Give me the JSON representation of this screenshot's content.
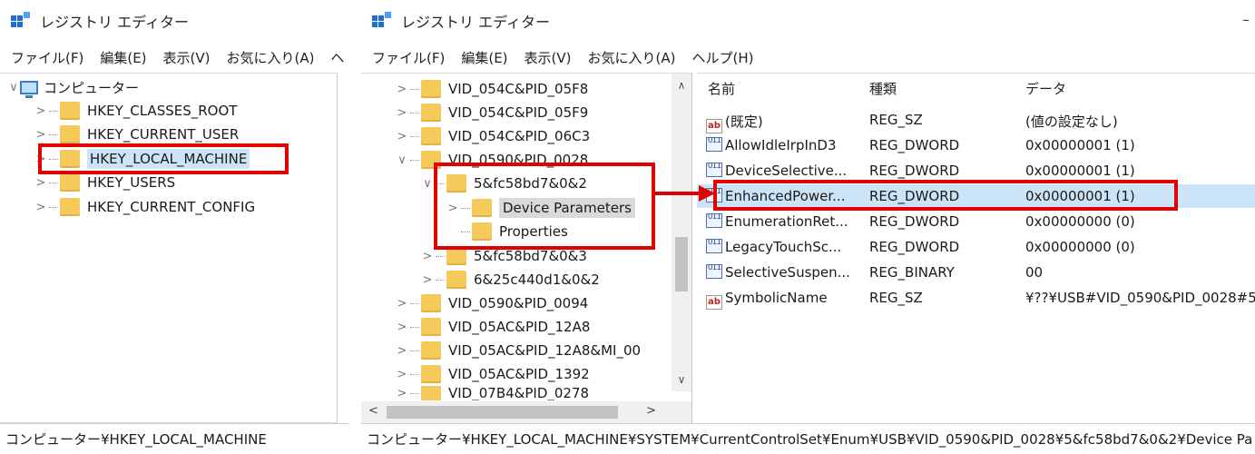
{
  "left_window": {
    "title": "レジストリ エディター",
    "menu": [
      "ファイル(F)",
      "編集(E)",
      "表示(V)",
      "お気に入り(A)",
      "ヘ"
    ],
    "tree": [
      {
        "label": "コンピューター",
        "expander": "∨"
      },
      {
        "label": "HKEY_CLASSES_ROOT",
        "expander": ">"
      },
      {
        "label": "HKEY_CURRENT_USER",
        "expander": ">"
      },
      {
        "label": "HKEY_LOCAL_MACHINE",
        "expander": ">"
      },
      {
        "label": "HKEY_USERS",
        "expander": ">"
      },
      {
        "label": "HKEY_CURRENT_CONFIG",
        "expander": ">"
      }
    ],
    "status": "コンピューター¥HKEY_LOCAL_MACHINE"
  },
  "right_window": {
    "title": "レジストリ エディター",
    "minimize": "–",
    "menu": [
      "ファイル(F)",
      "編集(E)",
      "表示(V)",
      "お気に入り(A)",
      "ヘルプ(H)"
    ],
    "tree": [
      {
        "label": "VID_054C&PID_05F8",
        "expander": ">"
      },
      {
        "label": "VID_054C&PID_05F9",
        "expander": ">"
      },
      {
        "label": "VID_054C&PID_06C3",
        "expander": ">"
      },
      {
        "label": "VID_0590&PID_0028",
        "expander": "∨"
      },
      {
        "label": "5&fc58bd7&0&2",
        "expander": "∨"
      },
      {
        "label": "Device Parameters",
        "expander": ">"
      },
      {
        "label": "Properties",
        "expander": ""
      },
      {
        "label": "5&fc58bd7&0&3",
        "expander": ">"
      },
      {
        "label": "6&25c440d1&0&2",
        "expander": ">"
      },
      {
        "label": "VID_0590&PID_0094",
        "expander": ">"
      },
      {
        "label": "VID_05AC&PID_12A8",
        "expander": ">"
      },
      {
        "label": "VID_05AC&PID_12A8&MI_00",
        "expander": ">"
      },
      {
        "label": "VID_05AC&PID_1392",
        "expander": ">"
      },
      {
        "label": "VID_07B4&PID_0278",
        "expander": ">"
      }
    ],
    "scroll": {
      "up": "∧",
      "down": "∨",
      "left": "<",
      "right": ">"
    },
    "columns": {
      "name": "名前",
      "type": "種類",
      "data": "データ"
    },
    "values": [
      {
        "icon": "ab",
        "name": "(既定)",
        "type": "REG_SZ",
        "data": "(値の設定なし)"
      },
      {
        "icon": "011",
        "name": "AllowIdleIrpInD3",
        "type": "REG_DWORD",
        "data": "0x00000001 (1)"
      },
      {
        "icon": "011",
        "name": "DeviceSelective...",
        "type": "REG_DWORD",
        "data": "0x00000001 (1)"
      },
      {
        "icon": "011",
        "name": "EnhancedPower...",
        "type": "REG_DWORD",
        "data": "0x00000001 (1)"
      },
      {
        "icon": "011",
        "name": "EnumerationRet...",
        "type": "REG_DWORD",
        "data": "0x00000000 (0)"
      },
      {
        "icon": "011",
        "name": "LegacyTouchSc...",
        "type": "REG_DWORD",
        "data": "0x00000000 (0)"
      },
      {
        "icon": "011",
        "name": "SelectiveSuspen...",
        "type": "REG_BINARY",
        "data": "00"
      },
      {
        "icon": "ab",
        "name": "SymbolicName",
        "type": "REG_SZ",
        "data": "¥??¥USB#VID_0590&PID_0028#5&"
      }
    ],
    "status": "コンピューター¥HKEY_LOCAL_MACHINE¥SYSTEM¥CurrentControlSet¥Enum¥USB¥VID_0590&PID_0028¥5&fc58bd7&0&2¥Device Pa"
  },
  "highlight_color": "#e00000"
}
